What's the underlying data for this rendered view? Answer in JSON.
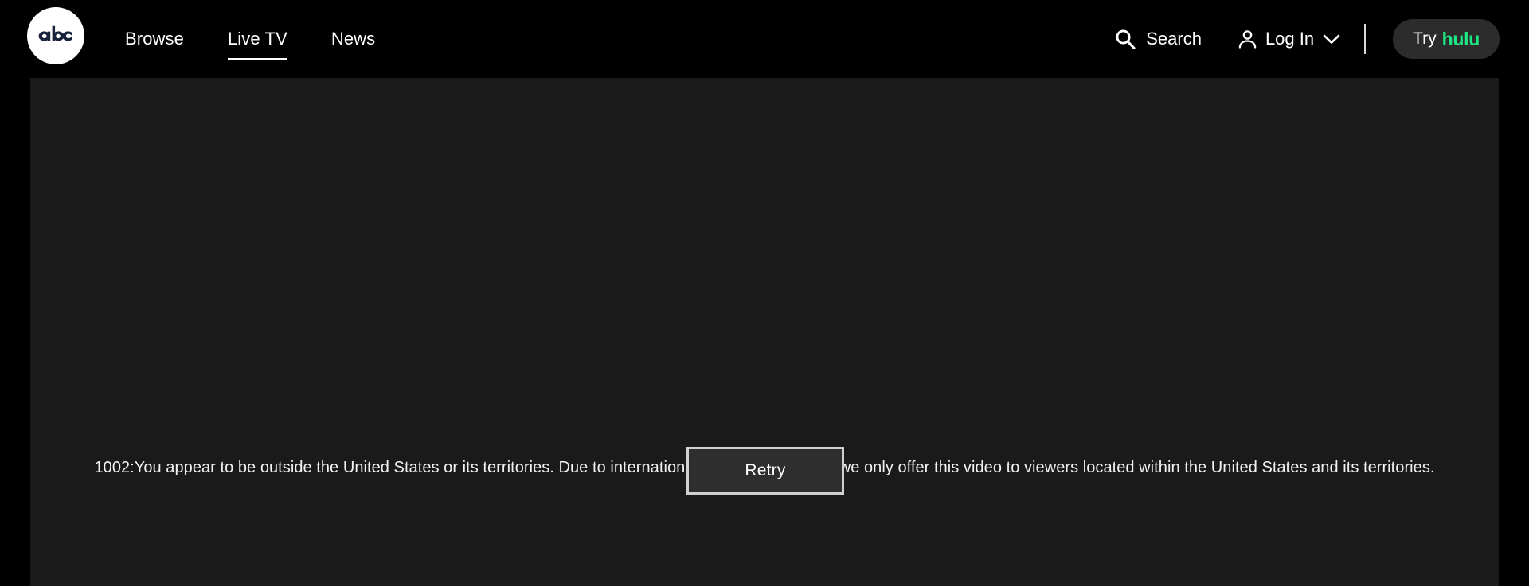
{
  "header": {
    "logo": {
      "name": "abc-logo",
      "text": "abc",
      "circle_color": "#ffffff",
      "letter_color": "#16233a"
    },
    "nav": [
      {
        "label": "Browse",
        "active": false
      },
      {
        "label": "Live TV",
        "active": true
      },
      {
        "label": "News",
        "active": false
      }
    ],
    "search": {
      "label": "Search",
      "icon": "search-icon"
    },
    "account": {
      "label": "Log In",
      "icon": "person-icon",
      "chevron": "chevron-down-icon"
    },
    "promo": {
      "prefix": "Try",
      "brand": "hulu",
      "brand_color": "#1ce783",
      "background": "#2c2c2c"
    },
    "background": "#000000"
  },
  "player": {
    "background": "#1a1a1a",
    "error": {
      "code": "1002",
      "message": "1002:You appear to be outside the United States or its territories. Due to international rights agreements, we only offer this video to viewers located within the United States and its territories.",
      "retry_label": "Retry"
    }
  }
}
